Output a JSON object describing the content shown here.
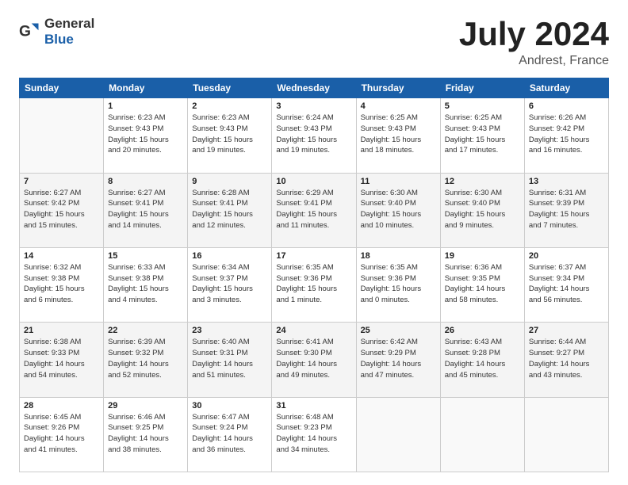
{
  "header": {
    "logo_general": "General",
    "logo_blue": "Blue",
    "month": "July 2024",
    "location": "Andrest, France"
  },
  "weekdays": [
    "Sunday",
    "Monday",
    "Tuesday",
    "Wednesday",
    "Thursday",
    "Friday",
    "Saturday"
  ],
  "weeks": [
    [
      {
        "day": "",
        "info": ""
      },
      {
        "day": "1",
        "info": "Sunrise: 6:23 AM\nSunset: 9:43 PM\nDaylight: 15 hours\nand 20 minutes."
      },
      {
        "day": "2",
        "info": "Sunrise: 6:23 AM\nSunset: 9:43 PM\nDaylight: 15 hours\nand 19 minutes."
      },
      {
        "day": "3",
        "info": "Sunrise: 6:24 AM\nSunset: 9:43 PM\nDaylight: 15 hours\nand 19 minutes."
      },
      {
        "day": "4",
        "info": "Sunrise: 6:25 AM\nSunset: 9:43 PM\nDaylight: 15 hours\nand 18 minutes."
      },
      {
        "day": "5",
        "info": "Sunrise: 6:25 AM\nSunset: 9:43 PM\nDaylight: 15 hours\nand 17 minutes."
      },
      {
        "day": "6",
        "info": "Sunrise: 6:26 AM\nSunset: 9:42 PM\nDaylight: 15 hours\nand 16 minutes."
      }
    ],
    [
      {
        "day": "7",
        "info": "Sunrise: 6:27 AM\nSunset: 9:42 PM\nDaylight: 15 hours\nand 15 minutes."
      },
      {
        "day": "8",
        "info": "Sunrise: 6:27 AM\nSunset: 9:41 PM\nDaylight: 15 hours\nand 14 minutes."
      },
      {
        "day": "9",
        "info": "Sunrise: 6:28 AM\nSunset: 9:41 PM\nDaylight: 15 hours\nand 12 minutes."
      },
      {
        "day": "10",
        "info": "Sunrise: 6:29 AM\nSunset: 9:41 PM\nDaylight: 15 hours\nand 11 minutes."
      },
      {
        "day": "11",
        "info": "Sunrise: 6:30 AM\nSunset: 9:40 PM\nDaylight: 15 hours\nand 10 minutes."
      },
      {
        "day": "12",
        "info": "Sunrise: 6:30 AM\nSunset: 9:40 PM\nDaylight: 15 hours\nand 9 minutes."
      },
      {
        "day": "13",
        "info": "Sunrise: 6:31 AM\nSunset: 9:39 PM\nDaylight: 15 hours\nand 7 minutes."
      }
    ],
    [
      {
        "day": "14",
        "info": "Sunrise: 6:32 AM\nSunset: 9:38 PM\nDaylight: 15 hours\nand 6 minutes."
      },
      {
        "day": "15",
        "info": "Sunrise: 6:33 AM\nSunset: 9:38 PM\nDaylight: 15 hours\nand 4 minutes."
      },
      {
        "day": "16",
        "info": "Sunrise: 6:34 AM\nSunset: 9:37 PM\nDaylight: 15 hours\nand 3 minutes."
      },
      {
        "day": "17",
        "info": "Sunrise: 6:35 AM\nSunset: 9:36 PM\nDaylight: 15 hours\nand 1 minute."
      },
      {
        "day": "18",
        "info": "Sunrise: 6:35 AM\nSunset: 9:36 PM\nDaylight: 15 hours\nand 0 minutes."
      },
      {
        "day": "19",
        "info": "Sunrise: 6:36 AM\nSunset: 9:35 PM\nDaylight: 14 hours\nand 58 minutes."
      },
      {
        "day": "20",
        "info": "Sunrise: 6:37 AM\nSunset: 9:34 PM\nDaylight: 14 hours\nand 56 minutes."
      }
    ],
    [
      {
        "day": "21",
        "info": "Sunrise: 6:38 AM\nSunset: 9:33 PM\nDaylight: 14 hours\nand 54 minutes."
      },
      {
        "day": "22",
        "info": "Sunrise: 6:39 AM\nSunset: 9:32 PM\nDaylight: 14 hours\nand 52 minutes."
      },
      {
        "day": "23",
        "info": "Sunrise: 6:40 AM\nSunset: 9:31 PM\nDaylight: 14 hours\nand 51 minutes."
      },
      {
        "day": "24",
        "info": "Sunrise: 6:41 AM\nSunset: 9:30 PM\nDaylight: 14 hours\nand 49 minutes."
      },
      {
        "day": "25",
        "info": "Sunrise: 6:42 AM\nSunset: 9:29 PM\nDaylight: 14 hours\nand 47 minutes."
      },
      {
        "day": "26",
        "info": "Sunrise: 6:43 AM\nSunset: 9:28 PM\nDaylight: 14 hours\nand 45 minutes."
      },
      {
        "day": "27",
        "info": "Sunrise: 6:44 AM\nSunset: 9:27 PM\nDaylight: 14 hours\nand 43 minutes."
      }
    ],
    [
      {
        "day": "28",
        "info": "Sunrise: 6:45 AM\nSunset: 9:26 PM\nDaylight: 14 hours\nand 41 minutes."
      },
      {
        "day": "29",
        "info": "Sunrise: 6:46 AM\nSunset: 9:25 PM\nDaylight: 14 hours\nand 38 minutes."
      },
      {
        "day": "30",
        "info": "Sunrise: 6:47 AM\nSunset: 9:24 PM\nDaylight: 14 hours\nand 36 minutes."
      },
      {
        "day": "31",
        "info": "Sunrise: 6:48 AM\nSunset: 9:23 PM\nDaylight: 14 hours\nand 34 minutes."
      },
      {
        "day": "",
        "info": ""
      },
      {
        "day": "",
        "info": ""
      },
      {
        "day": "",
        "info": ""
      }
    ]
  ]
}
